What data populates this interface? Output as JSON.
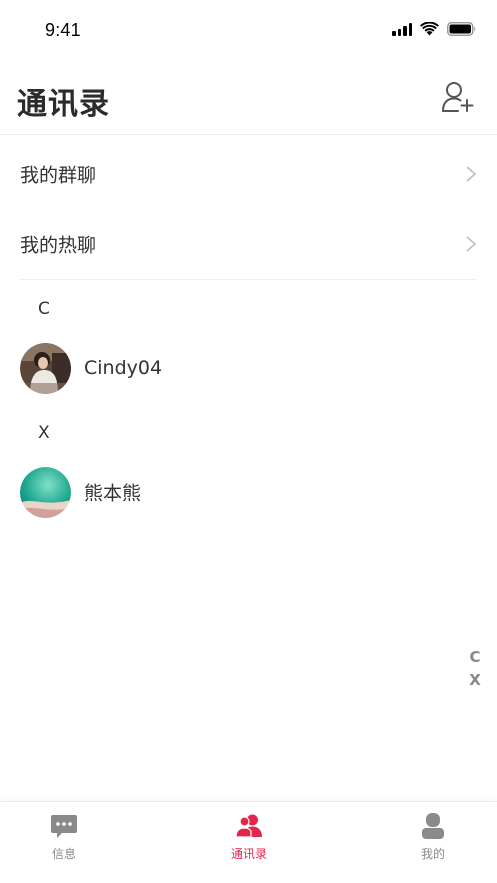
{
  "status_bar": {
    "time": "9:41"
  },
  "nav": {
    "title": "通讯录",
    "add_icon": "add-user-icon"
  },
  "menu": [
    {
      "label": "我的群聊"
    },
    {
      "label": "我的热聊"
    }
  ],
  "sections": [
    {
      "letter": "C",
      "contacts": [
        {
          "name": "Cindy04"
        }
      ]
    },
    {
      "letter": "X",
      "contacts": [
        {
          "name": "熊本熊"
        }
      ]
    }
  ],
  "index_bar": [
    "C",
    "X"
  ],
  "tabs": [
    {
      "label": "信息",
      "icon": "chat-icon",
      "active": false
    },
    {
      "label": "通讯录",
      "icon": "contacts-icon",
      "active": true
    },
    {
      "label": "我的",
      "icon": "profile-icon",
      "active": false
    }
  ],
  "colors": {
    "accent": "#e5264c",
    "inactive": "#8a8a8a"
  }
}
